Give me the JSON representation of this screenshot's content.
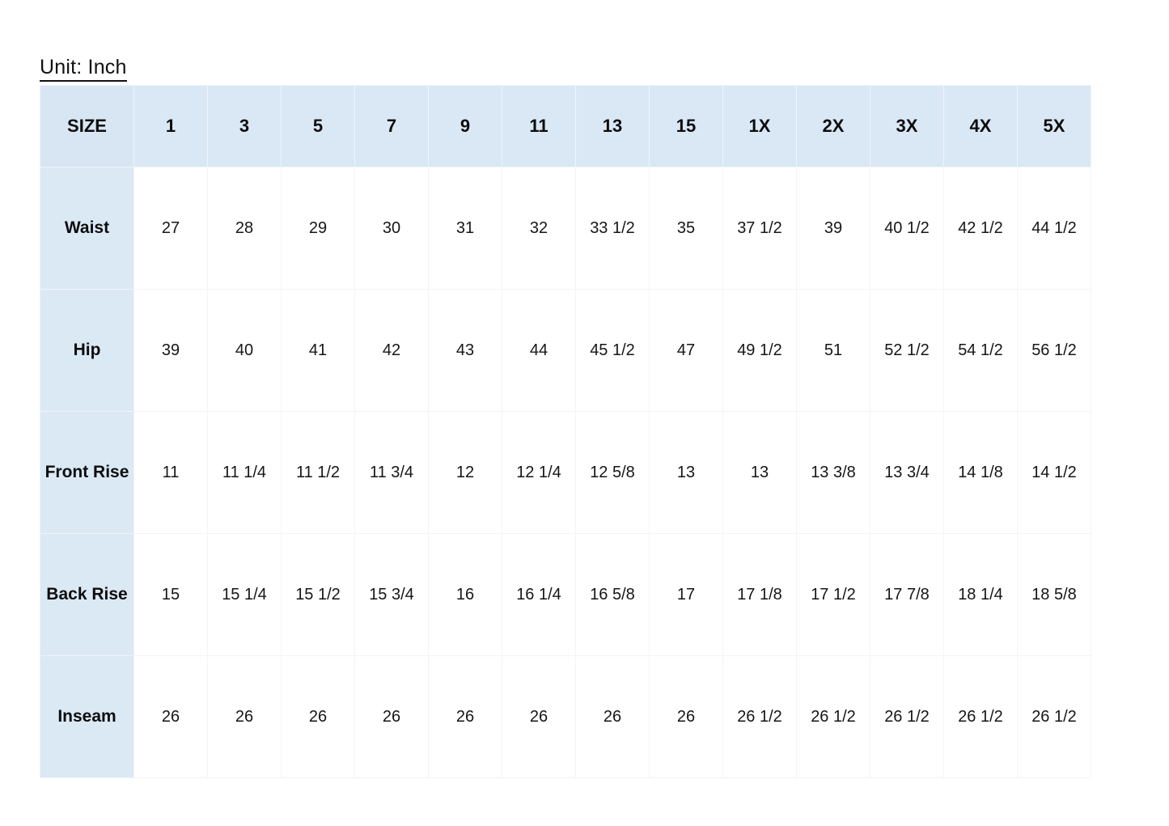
{
  "title": {
    "text": "Unit: Inch"
  },
  "colors": {
    "header_blue": "#dae8f5",
    "label_blue": "#dbe9f5",
    "gridline": "#f1f4f7",
    "text": "#161616",
    "page_background": "#ffffff"
  },
  "chart_data": {
    "type": "table",
    "title": "Unit: Inch",
    "corner_label": "SIZE",
    "categories": [
      "1",
      "3",
      "5",
      "7",
      "9",
      "11",
      "13",
      "15",
      "1X",
      "2X",
      "3X",
      "4X",
      "5X"
    ],
    "series": [
      {
        "name": "Waist",
        "values": [
          "27",
          "28",
          "29",
          "30",
          "31",
          "32",
          "33 1/2",
          "35",
          "37 1/2",
          "39",
          "40 1/2",
          "42 1/2",
          "44 1/2"
        ]
      },
      {
        "name": "Hip",
        "values": [
          "39",
          "40",
          "41",
          "42",
          "43",
          "44",
          "45 1/2",
          "47",
          "49 1/2",
          "51",
          "52 1/2",
          "54 1/2",
          "56 1/2"
        ]
      },
      {
        "name": "Front Rise",
        "values": [
          "11",
          "11 1/4",
          "11 1/2",
          "11 3/4",
          "12",
          "12 1/4",
          "12 5/8",
          "13",
          "13",
          "13 3/8",
          "13 3/4",
          "14 1/8",
          "14 1/2"
        ]
      },
      {
        "name": "Back Rise",
        "values": [
          "15",
          "15 1/4",
          "15 1/2",
          "15 3/4",
          "16",
          "16 1/4",
          "16 5/8",
          "17",
          "17 1/8",
          "17 1/2",
          "17 7/8",
          "18 1/4",
          "18 5/8"
        ]
      },
      {
        "name": "Inseam",
        "values": [
          "26",
          "26",
          "26",
          "26",
          "26",
          "26",
          "26",
          "26",
          "26 1/2",
          "26 1/2",
          "26 1/2",
          "26 1/2",
          "26 1/2"
        ]
      }
    ],
    "xlabel": "",
    "ylabel": "",
    "unit": "Inch"
  }
}
